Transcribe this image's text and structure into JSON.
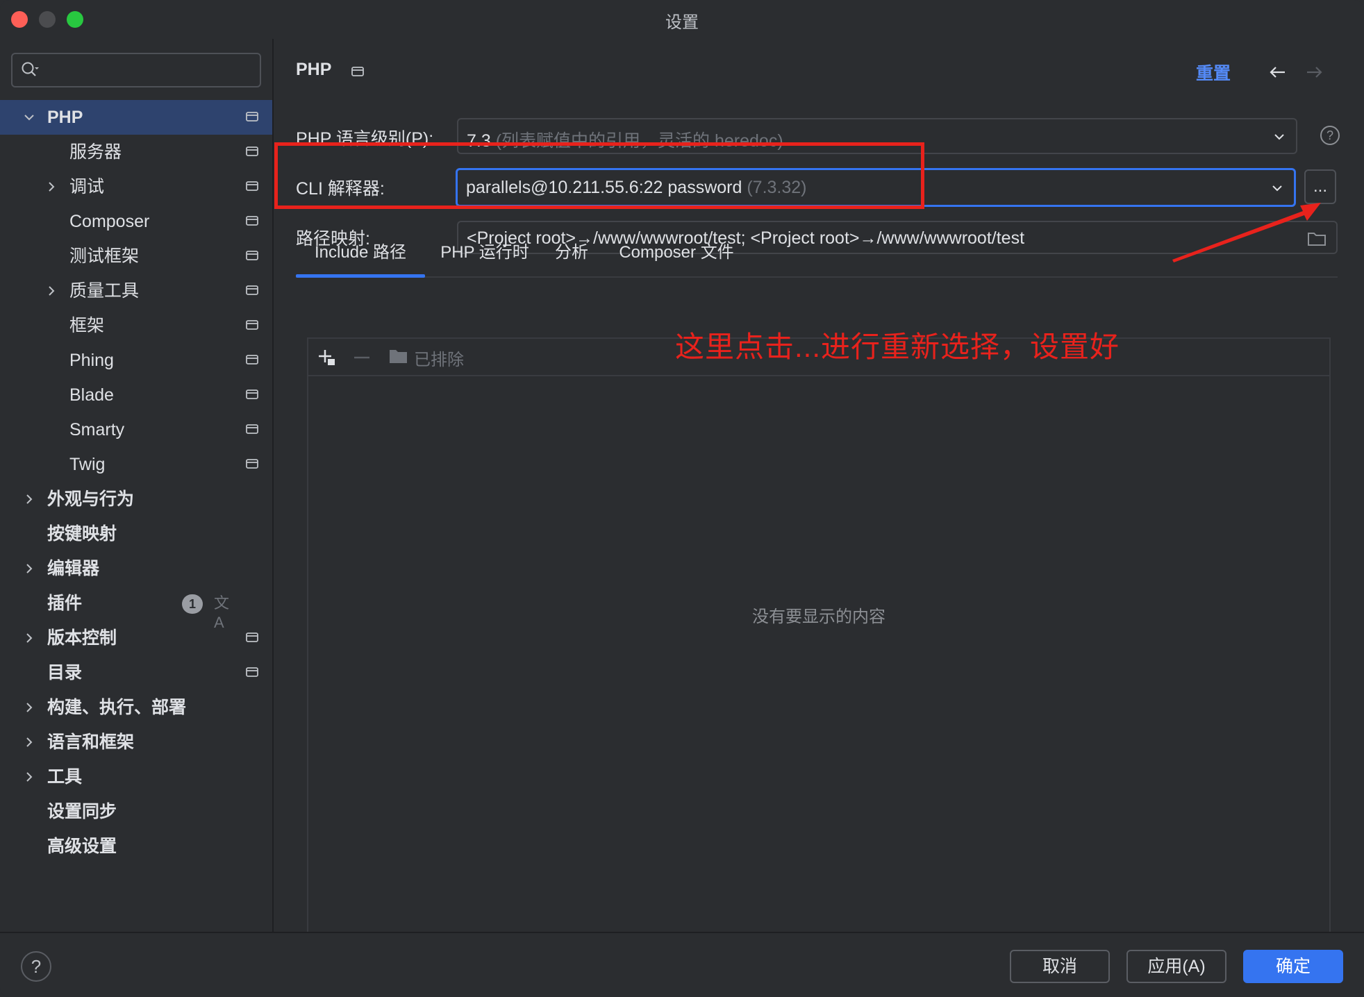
{
  "window": {
    "title": "设置"
  },
  "sidebar": {
    "search": {
      "value": "",
      "placeholder": ""
    },
    "items": [
      {
        "label": "PHP",
        "level": 0,
        "expanded": true,
        "selected": true,
        "project_icon": true
      },
      {
        "label": "服务器",
        "level": 1,
        "project_icon": true
      },
      {
        "label": "调试",
        "level": 1,
        "collapsed": true,
        "project_icon": true
      },
      {
        "label": "Composer",
        "level": 1,
        "project_icon": true
      },
      {
        "label": "测试框架",
        "level": 1,
        "project_icon": true
      },
      {
        "label": "质量工具",
        "level": 1,
        "collapsed": true,
        "project_icon": true
      },
      {
        "label": "框架",
        "level": 1,
        "project_icon": true
      },
      {
        "label": "Phing",
        "level": 1,
        "project_icon": true
      },
      {
        "label": "Blade",
        "level": 1,
        "project_icon": true
      },
      {
        "label": "Smarty",
        "level": 1,
        "project_icon": true
      },
      {
        "label": "Twig",
        "level": 1,
        "project_icon": true
      },
      {
        "label": "外观与行为",
        "level": 0,
        "collapsed": true
      },
      {
        "label": "按键映射",
        "level": 0
      },
      {
        "label": "编辑器",
        "level": 0,
        "collapsed": true
      },
      {
        "label": "插件",
        "level": 0,
        "badge": "1",
        "translate_icon": "文A"
      },
      {
        "label": "版本控制",
        "level": 0,
        "collapsed": true,
        "project_icon": true
      },
      {
        "label": "目录",
        "level": 0,
        "project_icon": true
      },
      {
        "label": "构建、执行、部署",
        "level": 0,
        "collapsed": true
      },
      {
        "label": "语言和框架",
        "level": 0,
        "collapsed": true
      },
      {
        "label": "工具",
        "level": 0,
        "collapsed": true
      },
      {
        "label": "设置同步",
        "level": 0
      },
      {
        "label": "高级设置",
        "level": 0
      }
    ]
  },
  "main": {
    "title": "PHP",
    "reset_label": "重置",
    "php_level": {
      "label": "PHP 语言级别(P):",
      "value": "7.3",
      "hint": "(列表赋值中的引用，灵活的 heredoc)"
    },
    "cli": {
      "label": "CLI 解释器:",
      "value": "parallels@10.211.55.6:22 password",
      "version": "(7.3.32)",
      "more_label": "..."
    },
    "path_mapping": {
      "label": "路径映射:",
      "value": "<Project root>→/www/wwwroot/test; <Project root>→/www/wwwroot/test"
    },
    "tabs": [
      {
        "label": "Include 路径",
        "active": true
      },
      {
        "label": "PHP 运行时"
      },
      {
        "label": "分析"
      },
      {
        "label": "Composer 文件"
      }
    ],
    "include_panel": {
      "excluded_label": "已排除",
      "empty_text": "没有要显示的内容"
    }
  },
  "annotation": {
    "text": "这里点击...进行重新选择，设置好",
    "color": "#e8221c"
  },
  "footer": {
    "help_label": "?",
    "cancel_label": "取消",
    "apply_label": "应用(A)",
    "ok_label": "确定"
  },
  "colors": {
    "background": "#2b2d30",
    "selection": "#2e436e",
    "accent": "#3574f0",
    "link": "#548af7",
    "muted": "#6f737a"
  }
}
